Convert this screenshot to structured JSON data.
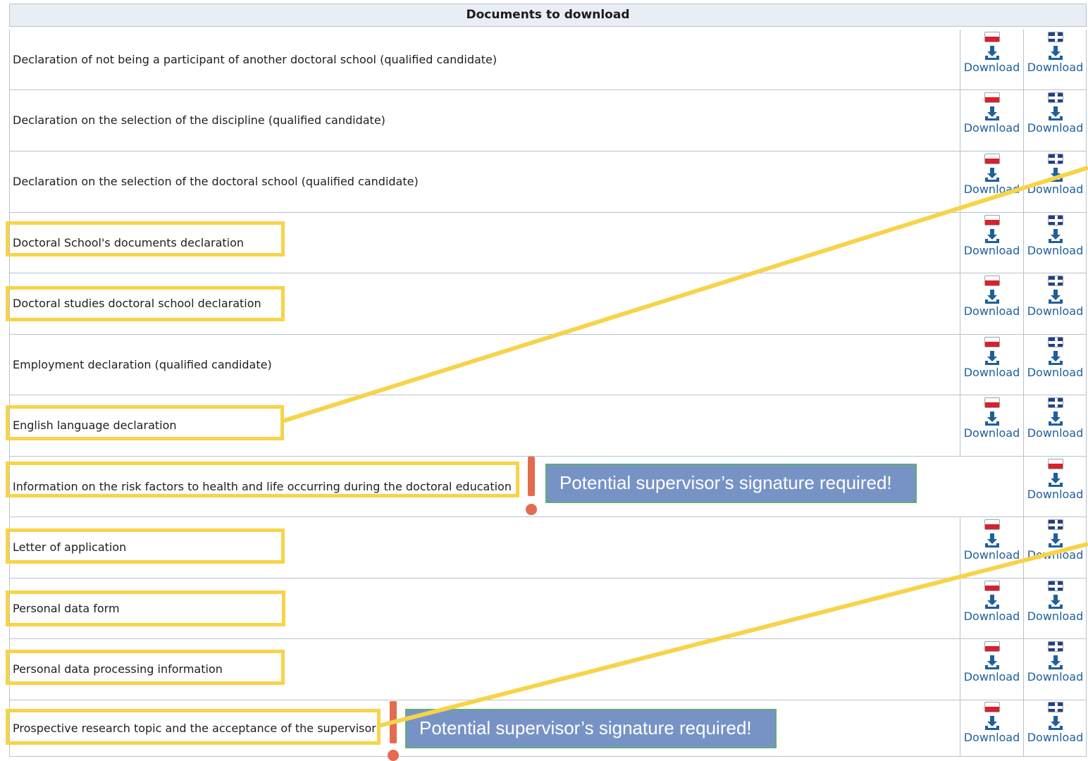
{
  "table": {
    "title": "Documents to download",
    "download_label": "Download",
    "rows": [
      {
        "name": "Declaration of not being a participant of another doctoral school (qualified candidate)",
        "pl": true,
        "en": true,
        "highlighted": false
      },
      {
        "name": "Declaration on the selection of the discipline (qualified candidate)",
        "pl": true,
        "en": true,
        "highlighted": false
      },
      {
        "name": "Declaration on the selection of the doctoral school (qualified candidate)",
        "pl": true,
        "en": true,
        "highlighted": false
      },
      {
        "name": "Doctoral School's documents declaration",
        "pl": true,
        "en": true,
        "highlighted": true
      },
      {
        "name": "Doctoral studies doctoral school declaration",
        "pl": true,
        "en": true,
        "highlighted": true
      },
      {
        "name": "Employment declaration (qualified candidate)",
        "pl": true,
        "en": true,
        "highlighted": false
      },
      {
        "name": "English language declaration",
        "pl": true,
        "en": true,
        "highlighted": true
      },
      {
        "name": "Information on the risk factors to health and life occurring during the doctoral education",
        "pl": false,
        "en": true,
        "en_flag": "pl",
        "highlighted": true
      },
      {
        "name": "Letter of application",
        "pl": true,
        "en": true,
        "highlighted": true
      },
      {
        "name": "Personal data form",
        "pl": true,
        "en": true,
        "highlighted": true
      },
      {
        "name": "Personal data processing information",
        "pl": true,
        "en": true,
        "highlighted": true
      },
      {
        "name": "Prospective research topic and the acceptance of the supervisor",
        "pl": true,
        "en": true,
        "highlighted": true
      }
    ]
  },
  "annotations": {
    "note_1": "Potential supervisor’s signature required!",
    "note_2": "Potential supervisor’s signature required!"
  },
  "colors": {
    "highlight": "#f7d34a",
    "note_background": "#7793c6",
    "exclamation": "#e36b4f",
    "link": "#1f5f9c"
  },
  "icons": {
    "polish_flag": "flag-pl-icon",
    "english_flag": "flag-uk-icon",
    "download": "download-tray-icon"
  }
}
